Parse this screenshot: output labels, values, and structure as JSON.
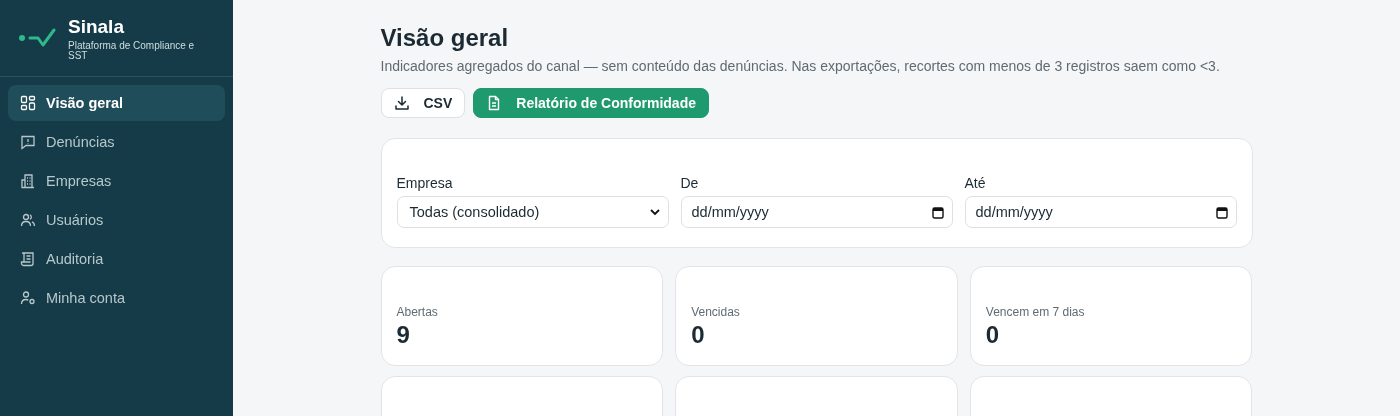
{
  "brand": {
    "name": "Sinala",
    "tagline": "Plataforma de Compliance e SST"
  },
  "sidebar": {
    "items": [
      {
        "label": "Visão geral",
        "kind": "grid",
        "selected": true
      },
      {
        "label": "Denúncias",
        "kind": "message",
        "selected": false
      },
      {
        "label": "Empresas",
        "kind": "building",
        "selected": false
      },
      {
        "label": "Usuários",
        "kind": "users",
        "selected": false
      },
      {
        "label": "Auditoria",
        "kind": "scroll",
        "selected": false
      },
      {
        "label": "Minha conta",
        "kind": "account",
        "selected": false
      }
    ]
  },
  "page": {
    "title": "Visão geral",
    "subtitle": "Indicadores agregados do canal — sem conteúdo das denúncias. Nas exportações, recortes com menos de 3 registros saem como <3."
  },
  "actions": [
    {
      "label": "CSV",
      "kind": "download"
    },
    {
      "label": "Relatório de Conformidade",
      "kind": "report"
    }
  ],
  "filters": [
    {
      "label": "Empresa",
      "kind": "select",
      "value": "Todas (consolidado)"
    },
    {
      "label": "De",
      "kind": "date",
      "placeholder": "dd/mm/yyyy"
    },
    {
      "label": "Até",
      "kind": "date",
      "placeholder": "dd/mm/yyyy"
    }
  ],
  "stats": [
    {
      "label": "Abertas",
      "value": "9"
    },
    {
      "label": "Vencidas",
      "value": "0"
    },
    {
      "label": "Vencem em 7 dias",
      "value": "0"
    }
  ]
}
